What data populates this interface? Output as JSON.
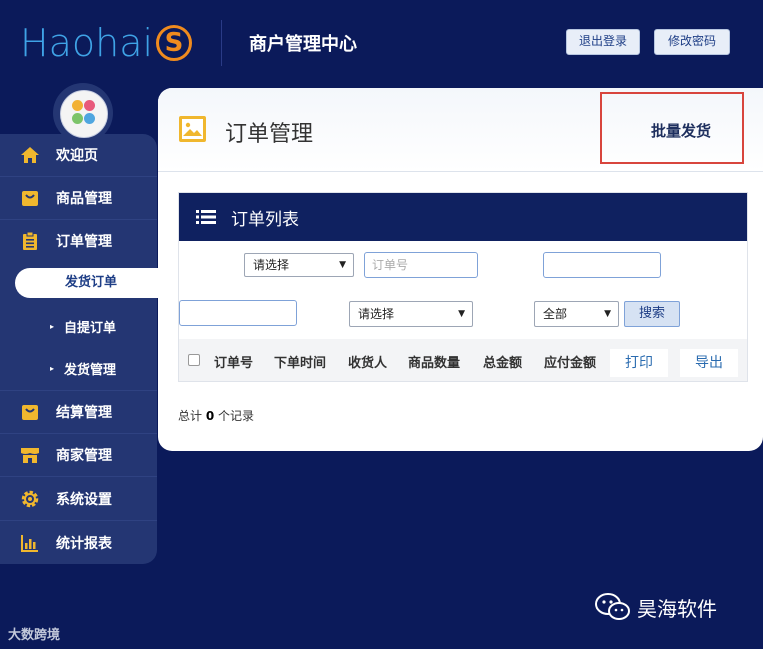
{
  "header": {
    "logo_text": "Haohai",
    "logo_mark": "S",
    "title": "商户管理中心",
    "logout_label": "退出登录",
    "change_password_label": "修改密码"
  },
  "sidebar": {
    "items": [
      {
        "label": "欢迎页",
        "icon": "home-icon"
      },
      {
        "label": "商品管理",
        "icon": "shopping-bag-icon"
      },
      {
        "label": "订单管理",
        "icon": "clipboard-icon"
      },
      {
        "label": "结算管理",
        "icon": "shopping-bag-icon"
      },
      {
        "label": "商家管理",
        "icon": "store-icon"
      },
      {
        "label": "系统设置",
        "icon": "gear-icon"
      },
      {
        "label": "统计报表",
        "icon": "bar-chart-icon"
      }
    ],
    "sub_items": [
      {
        "label": "发货订单",
        "active": true
      },
      {
        "label": "自提订单"
      },
      {
        "label": "发货管理"
      }
    ]
  },
  "main": {
    "title": "订单管理",
    "bulk_ship_label": "批量发货",
    "panel_title": "订单列表",
    "filters": {
      "select1_value": "请选择",
      "order_no_placeholder": "订单号",
      "select2_value": "请选择",
      "status_value": "全部",
      "search_label": "搜索"
    },
    "table": {
      "columns": [
        "订单号",
        "下单时间",
        "收货人",
        "商品数量",
        "总金额",
        "应付金额"
      ],
      "print_label": "打印",
      "export_label": "导出"
    },
    "total_prefix": "总计",
    "total_count": "0",
    "total_suffix": "个记录"
  },
  "footer": {
    "watermark_left": "大数跨境",
    "wechat_account": "昊海软件"
  },
  "colors": {
    "background": "#0b1a5a",
    "sidebar": "#243673",
    "panel_header": "#0f2160",
    "accent_orange": "#ef8b1e",
    "logo_blue": "#3fa3e6",
    "highlight_red": "#d8453d",
    "icon_yellow": "#f0b72e"
  }
}
